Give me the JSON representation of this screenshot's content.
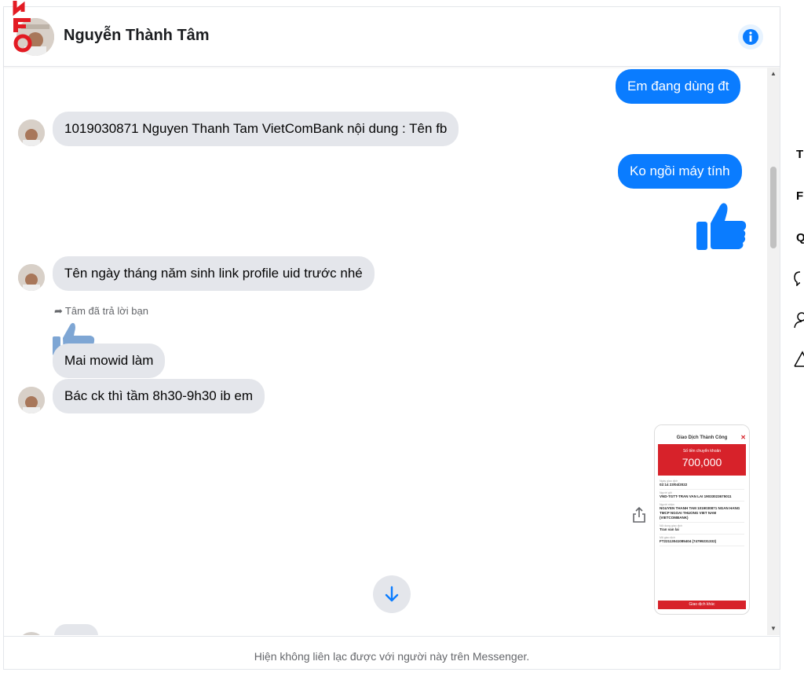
{
  "header": {
    "contact_name": "Nguyễn Thành Tâm"
  },
  "messages": {
    "out_1": "Em đang dùng đt",
    "in_1": "1019030871 Nguyen Thanh Tam VietComBank nội dung : Tên fb",
    "out_2": "Ko ngồi máy tính",
    "in_2": "Tên ngày tháng năm sinh link profile uid trước nhé",
    "reply_note": "Tâm đã trả lời bạn",
    "in_3": "Mai mowid làm",
    "in_4": "Bác ck thì tầm 8h30-9h30 ib em"
  },
  "receipt": {
    "title": "Giao Dịch Thành Công",
    "amount_label": "Số tiền chuyển khoản",
    "amount": "700,000",
    "fields": [
      {
        "label": "Ngày giao dịch",
        "value": "02:14 23/04/2022"
      },
      {
        "label": "Người gửi",
        "value": "VND-TGTT-TRAN VAN LAI 19033023675011"
      },
      {
        "label": "Người nhận",
        "value": "NGUYEN THANH TAM 1019030871 NGAN HANG TMCP NGOAI THUONG VIET NAM (VIETCOMBANK)"
      },
      {
        "label": "Nội dung giao dịch",
        "value": "Tran van lai"
      },
      {
        "label": "Mã giao dịch",
        "value": "FT22113041085404 (74799231332)"
      }
    ],
    "button": "Giao dịch khác"
  },
  "footer": {
    "notice": "Hiện không liên lạc được với người này trên Messenger."
  },
  "right_panel": {
    "items": [
      "T",
      "F",
      "Q"
    ]
  },
  "colors": {
    "messenger_blue": "#0a7cff",
    "incoming_bubble": "#e4e6eb",
    "receipt_red": "#d7222a",
    "logo_red": "#e31b23"
  },
  "icons": {
    "info": "info-icon",
    "like": "thumbs-up-icon",
    "share": "share-icon",
    "scroll": "arrow-down-icon",
    "reply": "reply-arrow-icon"
  }
}
